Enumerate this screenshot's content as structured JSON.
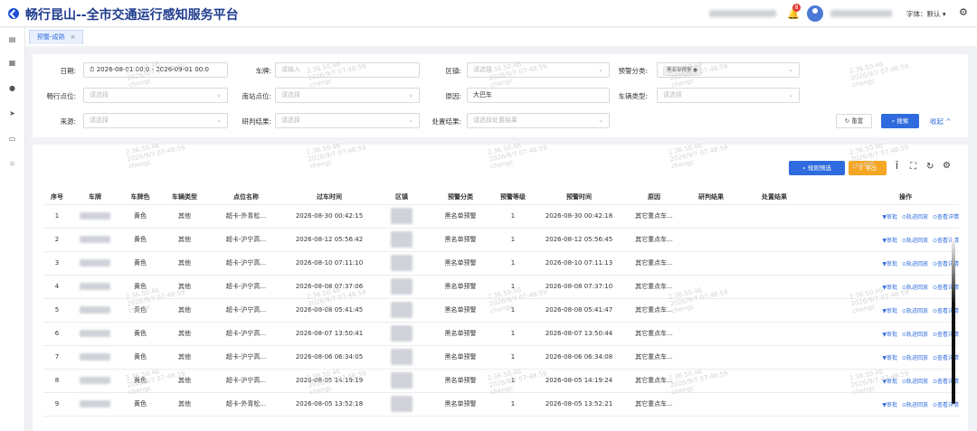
{
  "header": {
    "title": "畅行昆山--全市交通运行感知服务平台",
    "notification_count": "8",
    "font_label": "字体：默认 ▾"
  },
  "tab": {
    "label": "预警-成熟",
    "close": "×"
  },
  "filters": {
    "date_label": "日期:",
    "date_start": "2026-08-01 00:0",
    "date_sep": "-",
    "date_end": "2026-09-01 00:0",
    "plate_label": "车牌:",
    "plate_placeholder": "请输入",
    "area_label": "区镇:",
    "area_placeholder": "请选择",
    "warn_type_label": "预警分类:",
    "warn_type_tag": "黑名单预警",
    "cx_point_label": "畅行点位:",
    "cx_point_placeholder": "请选择",
    "nz_point_label": "南站点位:",
    "nz_point_placeholder": "请选择",
    "reason_label": "原因:",
    "reason_value": "大巴车",
    "vehicle_type_label": "车辆类型:",
    "vehicle_type_placeholder": "请选择",
    "source_label": "来源:",
    "source_placeholder": "请选择",
    "judge_label": "研判结果:",
    "judge_placeholder": "请选择",
    "handle_label": "处置结果:",
    "handle_placeholder": "请选择处置结果",
    "reset": "重置",
    "search": "搜索",
    "collapse": "收起 ^"
  },
  "toolbar": {
    "rule_filter": "规则预选",
    "export": "导出"
  },
  "table": {
    "headers": [
      "序号",
      "车牌",
      "车牌色",
      "车辆类型",
      "点位名称",
      "过车时间",
      "区镇",
      "预警分类",
      "预警等级",
      "预警时间",
      "原因",
      "研判结果",
      "处置结果",
      "操作"
    ],
    "rows": [
      {
        "no": "1",
        "color": "黄色",
        "vtype": "其他",
        "point": "超卡-外青松...",
        "pass_time": "2026-08-30 00:42:15",
        "category": "黑名单预警",
        "level": "1",
        "warn_time": "2026-08-30 00:42:18",
        "reason": "其它重点车..."
      },
      {
        "no": "2",
        "color": "黄色",
        "vtype": "其他",
        "point": "超卡-沪宁高...",
        "pass_time": "2026-08-12 05:56:42",
        "category": "黑名单预警",
        "level": "1",
        "warn_time": "2026-08-12 05:56:45",
        "reason": "其它重点车..."
      },
      {
        "no": "3",
        "color": "黄色",
        "vtype": "其他",
        "point": "超卡-沪宁高...",
        "pass_time": "2026-08-10 07:11:10",
        "category": "黑名单预警",
        "level": "1",
        "warn_time": "2026-08-10 07:11:13",
        "reason": "其它重点车..."
      },
      {
        "no": "4",
        "color": "黄色",
        "vtype": "其他",
        "point": "超卡-沪宁高...",
        "pass_time": "2026-08-08 07:37:06",
        "category": "黑名单预警",
        "level": "1",
        "warn_time": "2026-08-08 07:37:10",
        "reason": "其它重点车..."
      },
      {
        "no": "5",
        "color": "黄色",
        "vtype": "其他",
        "point": "超卡-沪宁高...",
        "pass_time": "2026-08-08 05:41:45",
        "category": "黑名单预警",
        "level": "1",
        "warn_time": "2026-08-08 05:41:47",
        "reason": "其它重点车..."
      },
      {
        "no": "6",
        "color": "黄色",
        "vtype": "其他",
        "point": "超卡-沪宁高...",
        "pass_time": "2026-08-07 13:50:41",
        "category": "黑名单预警",
        "level": "1",
        "warn_time": "2026-08-07 13:50:44",
        "reason": "其它重点车..."
      },
      {
        "no": "7",
        "color": "黄色",
        "vtype": "其他",
        "point": "超卡-沪宁高...",
        "pass_time": "2026-08-06 06:34:05",
        "category": "黑名单预警",
        "level": "1",
        "warn_time": "2026-08-06 06:34:08",
        "reason": "其它重点车..."
      },
      {
        "no": "8",
        "color": "黄色",
        "vtype": "其他",
        "point": "超卡-沪宁高...",
        "pass_time": "2026-08-05 14:19:19",
        "category": "黑名单预警",
        "level": "1",
        "warn_time": "2026-08-05 14:19:24",
        "reason": "其它重点车..."
      },
      {
        "no": "9",
        "color": "黄色",
        "vtype": "其他",
        "point": "超卡-外青松...",
        "pass_time": "2026-08-05 13:52:18",
        "category": "黑名单预警",
        "level": "1",
        "warn_time": "2026-08-05 13:52:21",
        "reason": "其它重点车..."
      }
    ],
    "ops": {
      "audit": "▼审批",
      "track": "⊙轨迹回放",
      "detail": "⊙查看详情"
    }
  },
  "watermark": {
    "line1": "2.36.50.46",
    "line2": "2026/9/7 07:48:59",
    "line3": "chengc"
  },
  "colors": {
    "accent": "#2f6bde",
    "warning": "#f5a623",
    "title": "#1f3c8f"
  }
}
